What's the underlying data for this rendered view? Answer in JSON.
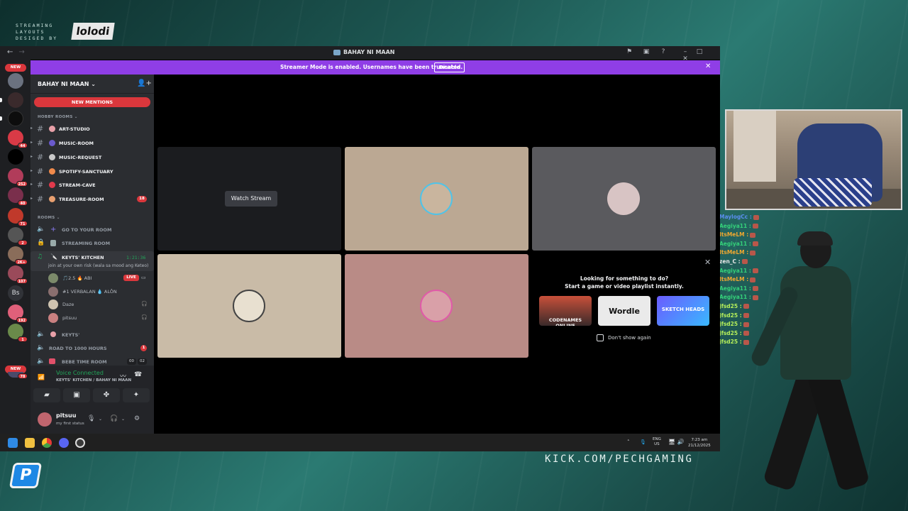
{
  "overlay": {
    "brand_sub": "STREAMING LAYOUTS DESIGED BY",
    "brand_logo": "lolodi",
    "kick_url": "KICK.COM/PECHGAMING",
    "p_logo": "P"
  },
  "window": {
    "title": "BAHAY NI MAAN",
    "streamer_banner": "Streamer Mode is enabled. Usernames have been truncated.",
    "disable_label": "Disable"
  },
  "rail": {
    "new_top": "NEW",
    "new_bottom": "NEW",
    "badges": [
      "44",
      "252",
      "40",
      "71",
      "2",
      "2K+",
      "107",
      "192",
      "1",
      "78"
    ],
    "text_server": "Bs"
  },
  "sidebar": {
    "server_name": "BAHAY NI MAAN",
    "new_mentions": "NEW MENTIONS",
    "cat_hobby": "HOBBY ROOMS",
    "cat_rooms": "ROOMS",
    "channels": [
      {
        "name": "ART-STUDIO",
        "badge": ""
      },
      {
        "name": "MUSIC-ROOM",
        "badge": ""
      },
      {
        "name": "MUSIC-REQUEST",
        "badge": ""
      },
      {
        "name": "SPOTIFY-SANCTUARY",
        "badge": ""
      },
      {
        "name": "STREAM-CAVE",
        "badge": ""
      },
      {
        "name": "TREASURE-ROOM",
        "badge": "18"
      }
    ],
    "voice": {
      "go_to_room": "GO TO YOUR ROOM",
      "streaming_room": "STREAMING ROOM",
      "kitchen": "KEYTS' KITCHEN",
      "kitchen_time": "1:21:36",
      "kitchen_status": "join at your own risk (wala sa mood ang Keteo)",
      "keyts": "KEYTS'",
      "road": "ROAD TO 1000 HOURS",
      "road_badge": "1",
      "bebe": "BEBE TIME ROOM",
      "bebe_count": "00",
      "bebe_count2": "02"
    },
    "users": [
      {
        "name": "🎵2.5 🔥 ABI",
        "live": "LIVE"
      },
      {
        "name": "#1 VERBALAN 💧 ALÔN"
      },
      {
        "name": "Daze"
      },
      {
        "name": "pitsuu"
      }
    ],
    "vc_title": "Voice Connected",
    "vc_sub": "KEYTS' KITCHEN / BAHAY NI MAAN",
    "user_name": "pitsuu",
    "user_status": "my first status"
  },
  "main": {
    "watch_stream": "Watch Stream",
    "promo_t1": "Looking for something to do?",
    "promo_t2": "Start a game or video playlist instantly.",
    "games": [
      "CODENAMES ONLINE",
      "Wordle",
      "SKETCH HEADS"
    ],
    "dont_show": "Don't show again"
  },
  "taskbar": {
    "lang": "ENG",
    "region": "US",
    "time": "7:23 am",
    "date": "21/12/2025"
  },
  "chat": [
    {
      "name": "MaylogCc :",
      "color": "#5b8ef0"
    },
    {
      "name": "Aegiya11 :",
      "color": "#34d17a"
    },
    {
      "name": "ItsMeLM :",
      "color": "#f0a830"
    },
    {
      "name": "Aegiya11 :",
      "color": "#34d17a"
    },
    {
      "name": "ItsMeLM :",
      "color": "#f0a830"
    },
    {
      "name": "zen_C :",
      "color": "#e8e8e8"
    },
    {
      "name": "Aegiya11 :",
      "color": "#34d17a"
    },
    {
      "name": "ItsMeLM :",
      "color": "#f0a830"
    },
    {
      "name": "Aegiya11 :",
      "color": "#34d17a"
    },
    {
      "name": "Aegiya11 :",
      "color": "#34d17a"
    },
    {
      "name": "jfsd25 :",
      "color": "#b6f05a"
    },
    {
      "name": "jfsd25 :",
      "color": "#b6f05a"
    },
    {
      "name": "jfsd25 :",
      "color": "#b6f05a"
    },
    {
      "name": "jfsd25 :",
      "color": "#b6f05a"
    },
    {
      "name": "jfsd25 :",
      "color": "#b6f05a"
    }
  ]
}
